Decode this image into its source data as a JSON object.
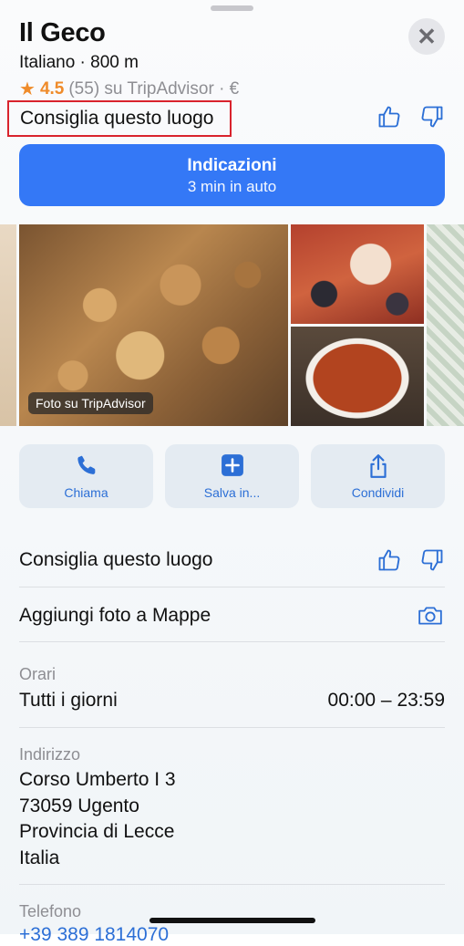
{
  "place": {
    "name": "Il Geco",
    "subtitle": "Italiano · 800 m",
    "rating": "4.5",
    "rating_detail": "(55) su TripAdvisor · €"
  },
  "recommend_top_label": "Consiglia questo luogo",
  "directions": {
    "title": "Indicazioni",
    "detail": "3 min in auto"
  },
  "photos": {
    "tag": "Foto su TripAdvisor"
  },
  "actions": [
    {
      "label": "Chiama",
      "icon": "phone-icon"
    },
    {
      "label": "Salva in...",
      "icon": "plus-square-icon"
    },
    {
      "label": "Condividi",
      "icon": "share-icon"
    }
  ],
  "list": {
    "recommend_label": "Consiglia questo luogo",
    "add_photo_label": "Aggiungi foto a Mappe"
  },
  "hours": {
    "label": "Orari",
    "days": "Tutti i giorni",
    "time": "00:00 – 23:59"
  },
  "address": {
    "label": "Indirizzo",
    "lines": [
      "Corso Umberto I 3",
      "73059 Ugento",
      "Provincia di Lecce",
      "Italia"
    ]
  },
  "phone": {
    "label": "Telefono",
    "number": "+39 389 1814070"
  },
  "colors": {
    "accent": "#3478f6",
    "link": "#2c6fd6",
    "star": "#ef8b2a",
    "highlight_border": "#d9232d"
  }
}
